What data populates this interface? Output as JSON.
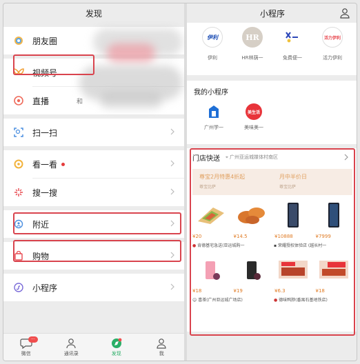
{
  "left": {
    "title": "发现",
    "groups": [
      {
        "items": [
          {
            "label": "朋友圈",
            "icon": "moments-icon"
          }
        ]
      },
      {
        "items": [
          {
            "label": "视频号",
            "icon": "channels-icon"
          },
          {
            "label": "直播",
            "icon": "live-icon",
            "sub": "和"
          }
        ]
      },
      {
        "items": [
          {
            "label": "扫一扫",
            "icon": "scan-icon"
          }
        ]
      },
      {
        "items": [
          {
            "label": "看一看",
            "icon": "top-stories-icon",
            "dot": true
          },
          {
            "label": "搜一搜",
            "icon": "search-icon"
          }
        ]
      },
      {
        "items": [
          {
            "label": "附近",
            "icon": "nearby-icon"
          }
        ]
      },
      {
        "items": [
          {
            "label": "购物",
            "icon": "shopping-icon"
          }
        ]
      },
      {
        "items": [
          {
            "label": "小程序",
            "icon": "mini-program-icon"
          }
        ]
      }
    ],
    "tabs": [
      {
        "label": "微信",
        "icon": "chat-icon",
        "badge": ""
      },
      {
        "label": "通讯录",
        "icon": "contacts-icon"
      },
      {
        "label": "发现",
        "icon": "discover-icon",
        "active": true
      },
      {
        "label": "我",
        "icon": "me-icon"
      }
    ]
  },
  "right": {
    "title": "小程序",
    "recent": [
      {
        "name": "伊利",
        "logo_text": "伊利",
        "icon": "yili-logo-icon"
      },
      {
        "name": "HR林荫一",
        "logo_text": "HR",
        "icon": "hr-logo-icon"
      },
      {
        "name": "免费便一",
        "logo_text": "",
        "icon": "mascot-logo-icon"
      },
      {
        "name": "活力伊利",
        "logo_text": "活力伊利",
        "icon": "huoli-yili-logo-icon"
      }
    ],
    "mine": {
      "title": "我的小程序",
      "apps": [
        {
          "name": "广州学一",
          "icon": "guangzhou-logo-icon"
        },
        {
          "name": "美味美一",
          "logo_text": "美生活",
          "icon": "meishenghuo-logo-icon"
        }
      ]
    },
    "store": {
      "title": "门店快送",
      "location": "广州亚运城媒体村南区",
      "promos": [
        {
          "title": "尊宝2月特惠4折起",
          "sub": "尊宝比萨"
        },
        {
          "title": "月中半价日",
          "sub": "尊宝比萨"
        }
      ],
      "row1": {
        "prices": [
          "¥20",
          "¥14.5",
          "¥10888",
          "¥7999"
        ],
        "shops": [
          "肯德基宅急送(亚运城购一",
          "荣耀授权体验店 (越长村一"
        ]
      },
      "row2": {
        "prices": [
          "¥18",
          "¥19",
          "¥6.3",
          "¥18"
        ],
        "shops": [
          "喜茶(广州亚运城广场店)",
          "德味鸭脖(番禺石基地铁店)"
        ]
      }
    }
  },
  "colors": {
    "highlight": "#d9434d",
    "price": "#e07b24",
    "wechat_green": "#2aae67"
  }
}
